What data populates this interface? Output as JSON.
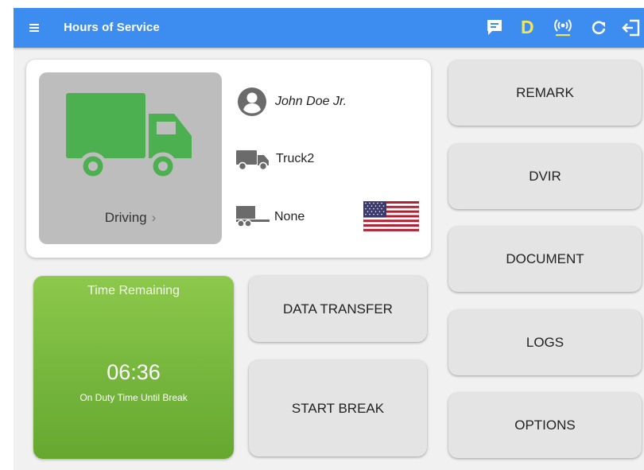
{
  "app_bar": {
    "title": "Hours of Service",
    "menu_icon": "hamburger-menu-icon",
    "actions": [
      {
        "icon": "message-icon"
      },
      {
        "label": "D"
      },
      {
        "icon": "antenna-signal-icon"
      },
      {
        "icon": "refresh-icon"
      },
      {
        "icon": "logout-icon"
      }
    ],
    "color": "#3d8df0"
  },
  "status": {
    "label": "Driving",
    "icon": "truck-icon",
    "icon_color": "#4caf50"
  },
  "driver": {
    "name": "John Doe Jr.",
    "icon": "account-circle-icon"
  },
  "vehicle": {
    "name": "Truck2",
    "icon": "truck-icon"
  },
  "trailer": {
    "name": "None",
    "icon": "trailer-icon"
  },
  "country": {
    "flag": "us-flag-icon"
  },
  "timer": {
    "title": "Time Remaining",
    "value": "06:36",
    "subtitle": "On Duty Time Until Break",
    "color": "#7cbd41"
  },
  "buttons": {
    "data_transfer": "DATA TRANSFER",
    "start_break": "START BREAK",
    "remark": "REMARK",
    "dvir": "DVIR",
    "document": "DOCUMENT",
    "logs": "LOGS",
    "options": "OPTIONS"
  }
}
